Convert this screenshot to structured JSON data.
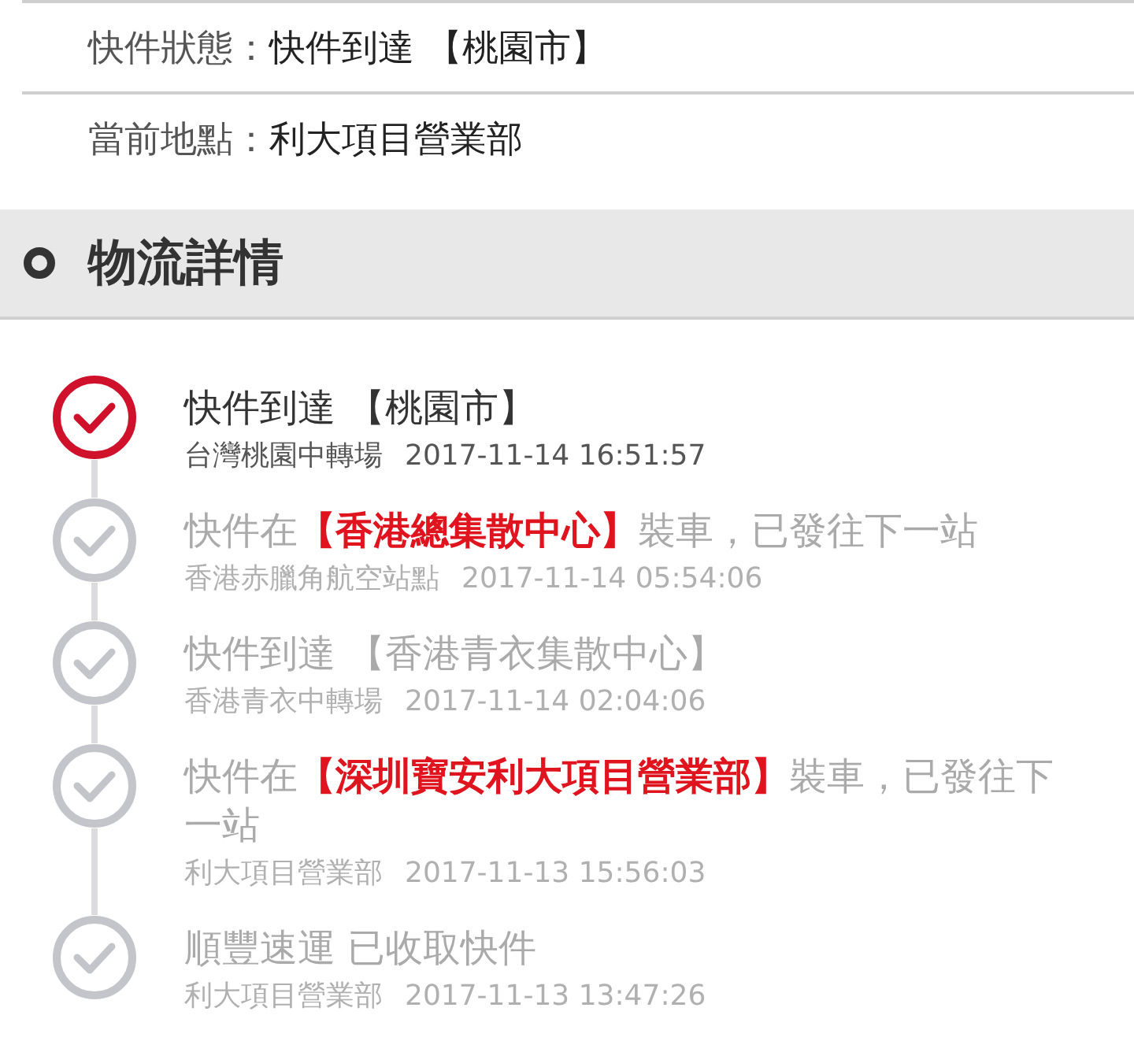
{
  "info_rows": [
    {
      "label": "快件狀態：",
      "value": "快件到達 【桃園市】"
    },
    {
      "label": "當前地點：",
      "value": "利大項目營業部"
    }
  ],
  "section": {
    "title": "物流詳情"
  },
  "events": [
    {
      "current": true,
      "title": [
        {
          "text": "快件到達 【桃園市】",
          "highlight": false
        }
      ],
      "location": "台灣桃園中轉場",
      "time": "2017-11-14 16:51:57"
    },
    {
      "current": false,
      "title": [
        {
          "text": "快件在",
          "highlight": false
        },
        {
          "text": "【香港總集散中心】",
          "highlight": true
        },
        {
          "text": "裝車，已發往下一站",
          "highlight": false
        }
      ],
      "location": "香港赤臘角航空站點",
      "time": "2017-11-14 05:54:06"
    },
    {
      "current": false,
      "title": [
        {
          "text": "快件到達 【香港青衣集散中心】",
          "highlight": false
        }
      ],
      "location": "香港青衣中轉場",
      "time": "2017-11-14 02:04:06"
    },
    {
      "current": false,
      "title": [
        {
          "text": "快件在",
          "highlight": false
        },
        {
          "text": "【深圳寶安利大項目營業部】",
          "highlight": true
        },
        {
          "text": "裝車，已發往下一站",
          "highlight": false
        }
      ],
      "location": "利大項目營業部",
      "time": "2017-11-13 15:56:03"
    },
    {
      "current": false,
      "title": [
        {
          "text": "順豐速運 已收取快件",
          "highlight": false
        }
      ],
      "location": "利大項目營業部",
      "time": "2017-11-13 13:47:26"
    }
  ]
}
